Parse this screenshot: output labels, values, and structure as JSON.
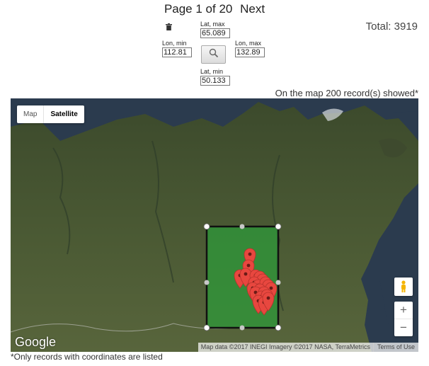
{
  "pager": {
    "page_label": "Page 1 of 20",
    "next_label": "Next"
  },
  "total": "Total: 3919",
  "filters": {
    "lat_max": {
      "label": "Lat, max",
      "value": "65.089"
    },
    "lat_min": {
      "label": "Lat, min",
      "value": "50.133"
    },
    "lon_min": {
      "label": "Lon, min",
      "value": "112.81"
    },
    "lon_max": {
      "label": "Lon, max",
      "value": "132.89"
    }
  },
  "icons": {
    "trash": "trash-icon",
    "search": "magnifier-icon",
    "pegman": "pegman-icon"
  },
  "records_note": "On the map 200 record(s) showed*",
  "map": {
    "type_buttons": {
      "map": "Map",
      "satellite": "Satellite"
    },
    "selected_type": "Satellite",
    "zoom_in": "+",
    "zoom_out": "−",
    "logo": "Google",
    "attribution": "Map data ©2017 INEGI Imagery ©2017 NASA, TerraMetrics",
    "terms": "Terms of Use",
    "colors": {
      "selection_fill": "#2e9a3a",
      "marker": "#e8473f",
      "water": "#2a3a4c",
      "land": "#4a5a33"
    }
  },
  "footnote": "*Only records with coordinates are listed"
}
